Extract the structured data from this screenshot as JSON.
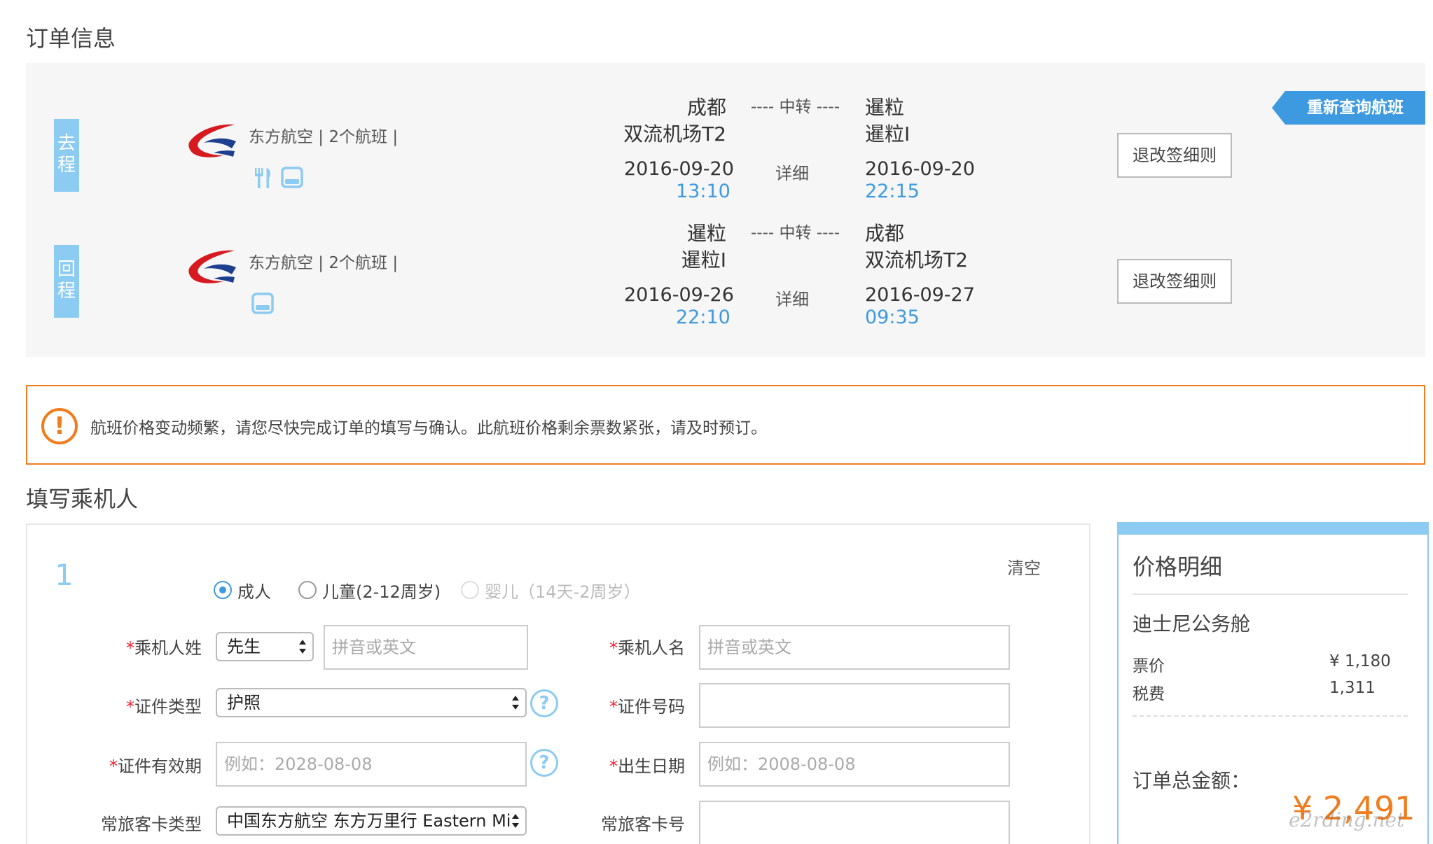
{
  "order_section": {
    "title": "订单信息",
    "requery_button": "重新查询航班"
  },
  "flights": [
    {
      "tag": "去程",
      "airline": "东方航空 | 2个航班 |",
      "amenities": [
        "meal-icon",
        "seat-icon"
      ],
      "dep_city": "成都",
      "dep_airport": "双流机场T2",
      "dep_date": "2016-09-20",
      "dep_time": "13:10",
      "transfer": "---- 中转 ----",
      "detail": "详细",
      "arr_city": "暹粒",
      "arr_airport": "暹粒I",
      "arr_date": "2016-09-20",
      "arr_time": "22:15",
      "rules_button": "退改签细则"
    },
    {
      "tag": "回程",
      "airline": "东方航空 | 2个航班 |",
      "amenities": [
        "seat-icon"
      ],
      "dep_city": "暹粒",
      "dep_airport": "暹粒I",
      "dep_date": "2016-09-26",
      "dep_time": "22:10",
      "transfer": "---- 中转 ----",
      "detail": "详细",
      "arr_city": "成都",
      "arr_airport": "双流机场T2",
      "arr_date": "2016-09-27",
      "arr_time": "09:35",
      "rules_button": "退改签细则"
    }
  ],
  "notice": {
    "icon": "!",
    "text": "航班价格变动频繁，请您尽快完成订单的填写与确认。此航班价格剩余票数紧张，请及时预订。"
  },
  "passenger_section": {
    "title": "填写乘机人",
    "number": "1",
    "clear": "清空",
    "types": [
      {
        "label": "成人",
        "checked": true,
        "disabled": false
      },
      {
        "label": "儿童(2-12周岁)",
        "checked": false,
        "disabled": false
      },
      {
        "label": "婴儿（14天-2周岁）",
        "checked": false,
        "disabled": true
      }
    ],
    "fields": {
      "required_mark": "*",
      "surname_label": "乘机人姓",
      "title_select": "先生",
      "surname_placeholder": "拼音或英文",
      "given_name_label": "乘机人名",
      "given_name_placeholder": "拼音或英文",
      "id_type_label": "证件类型",
      "id_type_select": "护照",
      "id_number_label": "证件号码",
      "id_expiry_label": "证件有效期",
      "id_expiry_placeholder": "例如：2028-08-08",
      "birth_label": "出生日期",
      "birth_placeholder": "例如：2008-08-08",
      "ffp_type_label": "常旅客卡类型",
      "ffp_type_select": "中国东方航空 东方万里行 Eastern Mi",
      "ffp_number_label": "常旅客卡号",
      "help": "?"
    }
  },
  "price": {
    "title": "价格明细",
    "cabin": "迪士尼公务舱",
    "fare_label": "票价",
    "fare_value": "¥ 1,180",
    "tax_label": "税费",
    "tax_value": "1,311",
    "total_label": "订单总金额：",
    "total_value": "¥ 2,491"
  },
  "watermark": "e2rding.net",
  "colors": {
    "accent_blue": "#3d9ae0",
    "light_blue": "#8ccbf2",
    "warning_orange": "#ef7d1e",
    "panel_gray": "#f6f6f6"
  }
}
